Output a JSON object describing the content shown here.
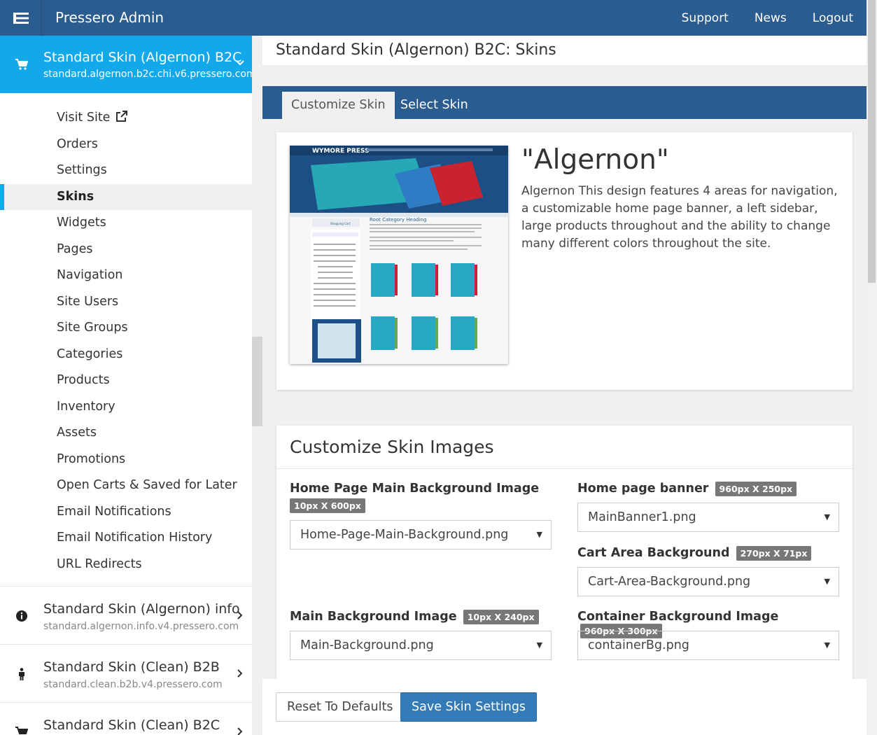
{
  "topbar": {
    "title": "Pressero Admin",
    "nav": [
      "Support",
      "News",
      "Logout"
    ]
  },
  "sidebar": {
    "active_site": {
      "name": "Standard Skin (Algernon) B2C",
      "url": "standard.algernon.b2c.chi.v6.pressero.com"
    },
    "items": [
      {
        "label": "Visit Site"
      },
      {
        "label": "Orders"
      },
      {
        "label": "Settings"
      },
      {
        "label": "Skins"
      },
      {
        "label": "Widgets"
      },
      {
        "label": "Pages"
      },
      {
        "label": "Navigation"
      },
      {
        "label": "Site Users"
      },
      {
        "label": "Site Groups"
      },
      {
        "label": "Categories"
      },
      {
        "label": "Products"
      },
      {
        "label": "Inventory"
      },
      {
        "label": "Assets"
      },
      {
        "label": "Promotions"
      },
      {
        "label": "Open Carts & Saved for Later"
      },
      {
        "label": "Email Notifications"
      },
      {
        "label": "Email Notification History"
      },
      {
        "label": "URL Redirects"
      }
    ],
    "active_item": "Skins",
    "other_sites": [
      {
        "name": "Standard Skin (Algernon) info",
        "url": "standard.algernon.info.v4.pressero.com",
        "icon": "info-icon"
      },
      {
        "name": "Standard Skin (Clean) B2B",
        "url": "standard.clean.b2b.v4.pressero.com",
        "icon": "person-icon"
      },
      {
        "name": "Standard Skin (Clean) B2C",
        "url": "",
        "icon": "cart-icon"
      }
    ]
  },
  "main": {
    "page_title": "Standard Skin (Algernon) B2C: Skins",
    "tabs": [
      {
        "label": "Customize Skin",
        "active": true
      },
      {
        "label": "Select Skin",
        "active": false
      }
    ],
    "skin": {
      "name": "\"Algernon\"",
      "description": "Algernon This design features 4 areas for navigation, a customizable home page banner, a left sidebar, large products throughout and the ability to change many different colors throughout the site.",
      "preview": {
        "logo": "WYMORE PRESS",
        "heading": "Root Category Heading",
        "cart": "Shopping Cart"
      }
    },
    "images_section": {
      "title": "Customize Skin Images",
      "fields": [
        {
          "label": "Home Page Main Background Image",
          "size": "10px X 600px",
          "value": "Home-Page-Main-Background.png"
        },
        {
          "label": "Home page banner",
          "size": "960px X 250px",
          "value": "MainBanner1.png"
        },
        {
          "label": "Cart Area Background",
          "size": "270px X 71px",
          "value": "Cart-Area-Background.png"
        },
        {
          "label": "Main Background Image",
          "size": "10px X 240px",
          "value": "Main-Background.png"
        },
        {
          "label": "Container Background Image",
          "size": "960px X 300px",
          "value": "containerBg.png"
        }
      ]
    },
    "buttons": {
      "reset": "Reset To Defaults",
      "save": "Save Skin Settings"
    }
  },
  "colors": {
    "topbar": "#2b5c8f",
    "active_site": "#13a8ea",
    "primary_button": "#337ab7"
  }
}
